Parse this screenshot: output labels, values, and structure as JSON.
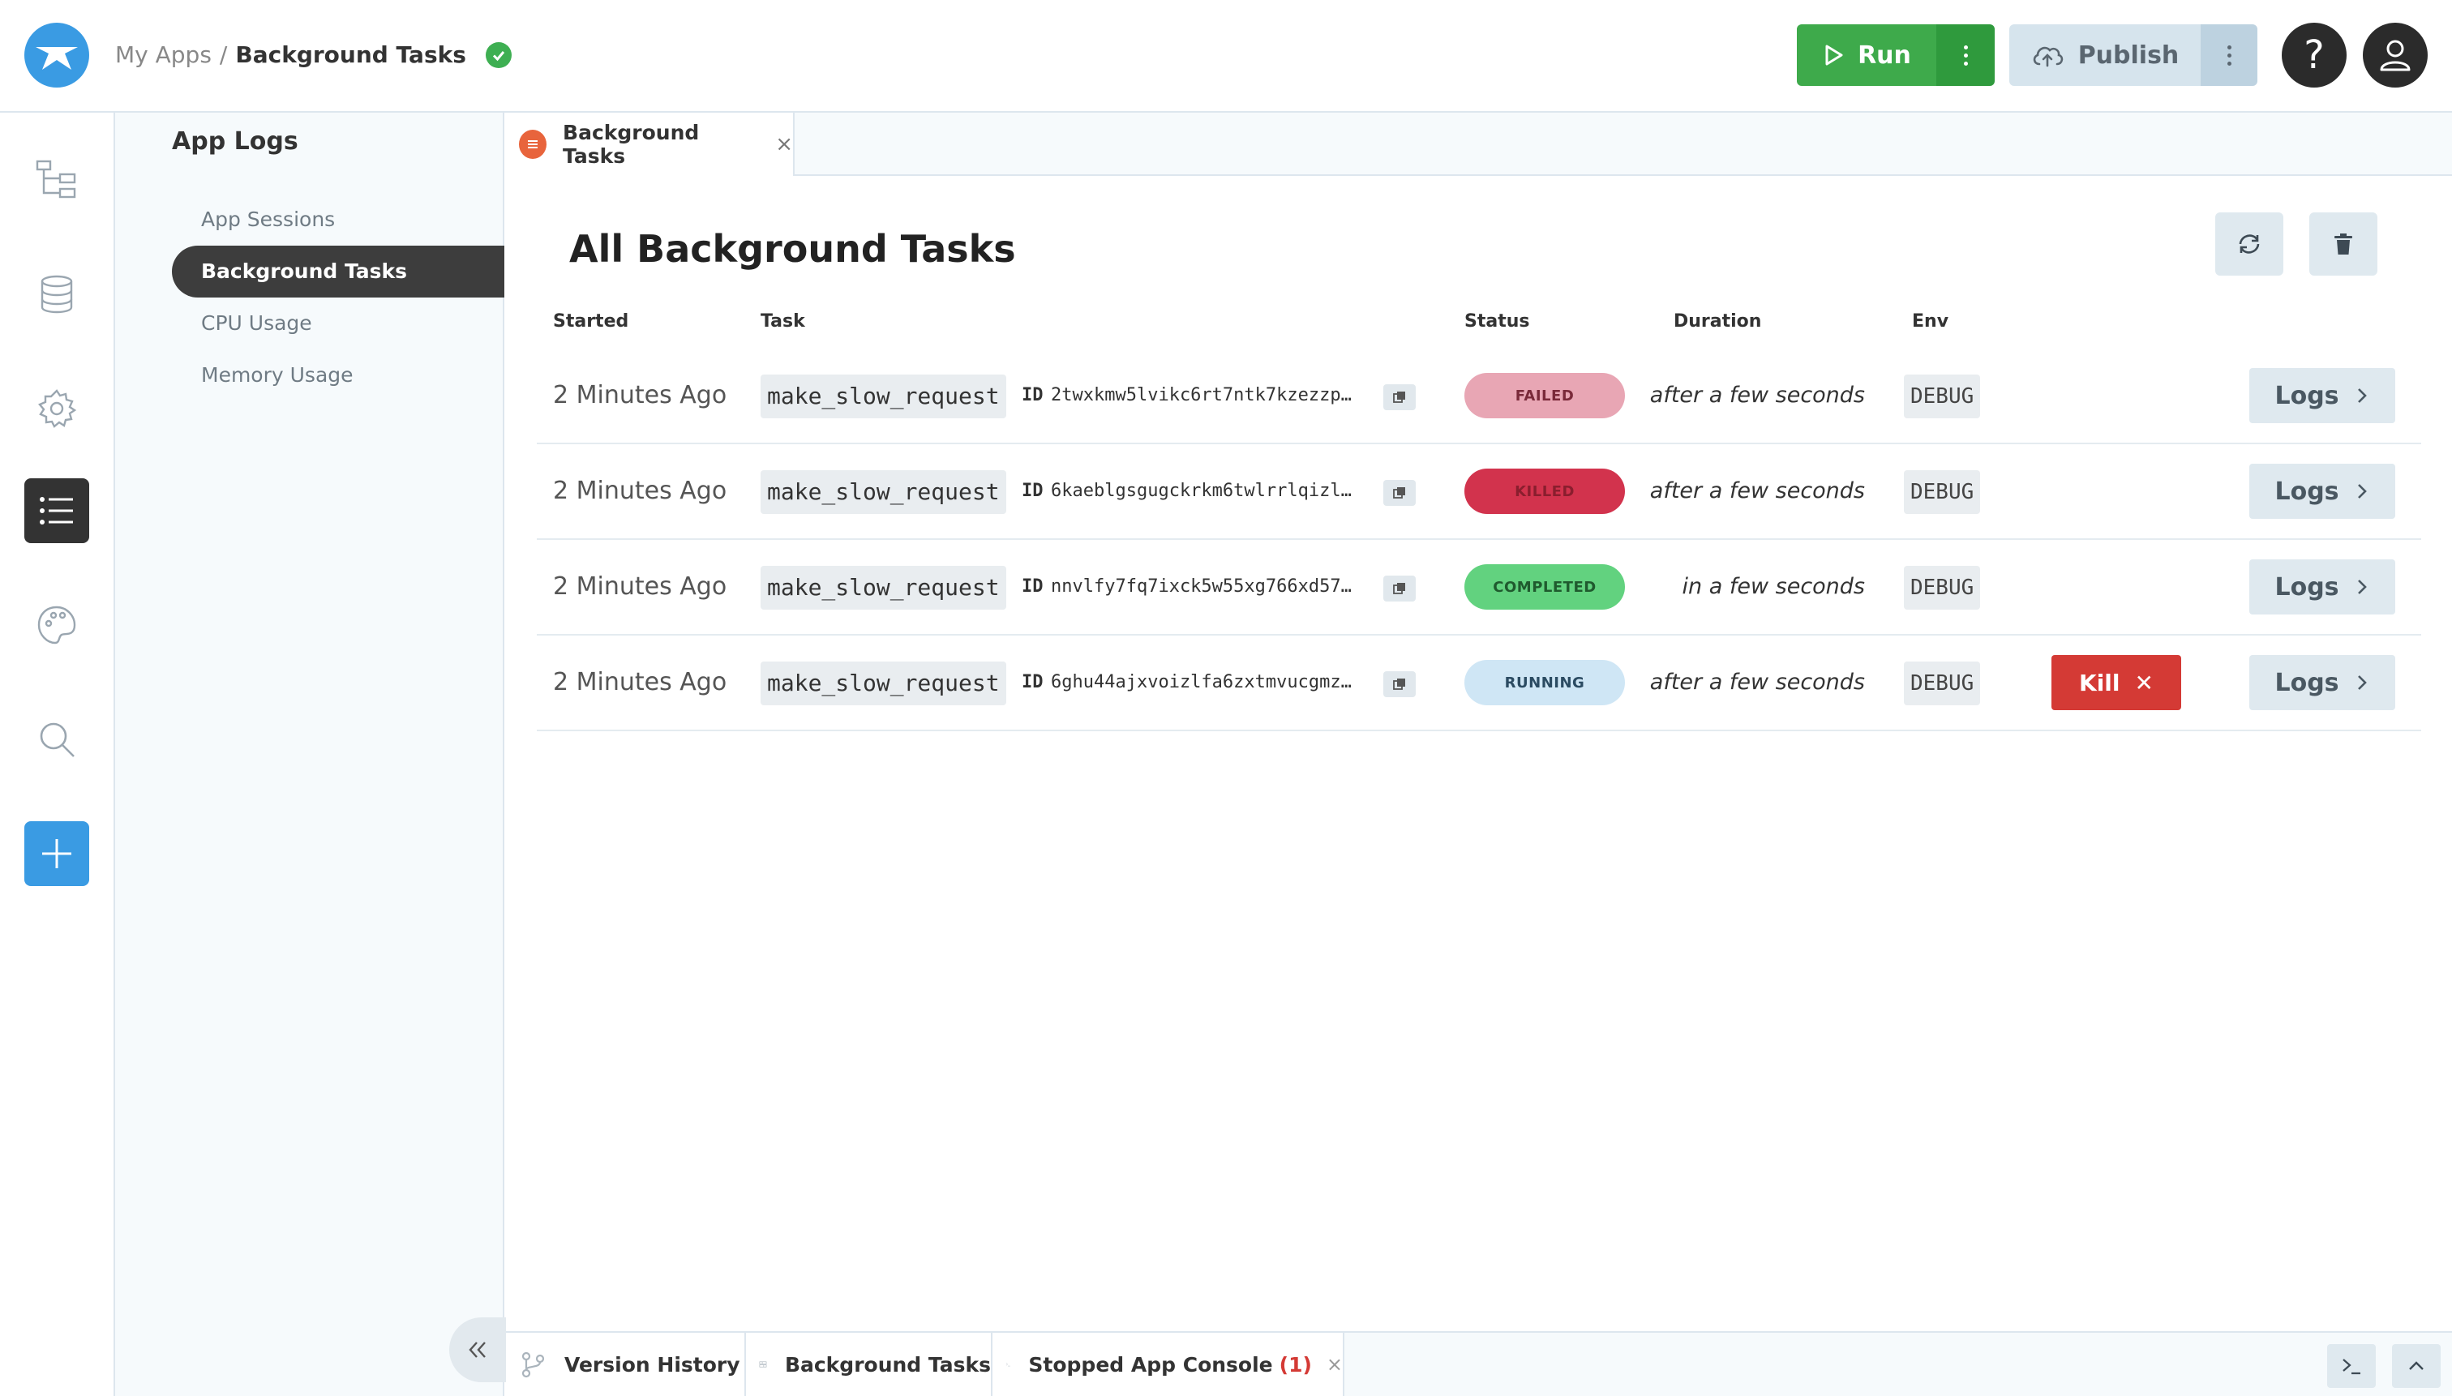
{
  "header": {
    "breadcrumb_root": "My Apps",
    "breadcrumb_separator": "/",
    "breadcrumb_current": "Background Tasks",
    "run_label": "Run",
    "publish_label": "Publish",
    "help_label": "?",
    "colors": {
      "run": "#3eaa4b",
      "publish": "#d6e4ed",
      "brand": "#3a9be3"
    }
  },
  "rail": {
    "icons": [
      "files-icon",
      "database-icon",
      "settings-icon",
      "logs-icon",
      "palette-icon",
      "search-icon",
      "add-icon"
    ],
    "active": "logs-icon"
  },
  "subnav": {
    "title": "App Logs",
    "items": [
      {
        "label": "App Sessions"
      },
      {
        "label": "Background Tasks"
      },
      {
        "label": "CPU Usage"
      },
      {
        "label": "Memory Usage"
      }
    ],
    "active_index": 1
  },
  "tab": {
    "label": "Background Tasks",
    "close": "×"
  },
  "main": {
    "title": "All Background Tasks",
    "columns": [
      "Started",
      "Task",
      "Status",
      "Duration",
      "Env"
    ],
    "rows": [
      {
        "started": "2 Minutes Ago",
        "task": "make_slow_request",
        "id_label": "ID",
        "id": "2twxkmw5lvikc6rt7ntk7kzezzp…",
        "status": "FAILED",
        "duration": "after a few seconds",
        "env": "DEBUG",
        "logs": "Logs"
      },
      {
        "started": "2 Minutes Ago",
        "task": "make_slow_request",
        "id_label": "ID",
        "id": "6kaeblgsgugckrkm6twlrrlqizl…",
        "status": "KILLED",
        "duration": "after a few seconds",
        "env": "DEBUG",
        "logs": "Logs"
      },
      {
        "started": "2 Minutes Ago",
        "task": "make_slow_request",
        "id_label": "ID",
        "id": "nnvlfy7fq7ixck5w55xg766xd57…",
        "status": "COMPLETED",
        "duration": "in a few seconds",
        "env": "DEBUG",
        "logs": "Logs"
      },
      {
        "started": "2 Minutes Ago",
        "task": "make_slow_request",
        "id_label": "ID",
        "id": "6ghu44ajxvoizlfa6zxtmvucgmz…",
        "status": "RUNNING",
        "duration": "after a few seconds",
        "env": "DEBUG",
        "kill": "Kill",
        "logs": "Logs"
      }
    ],
    "status_colors": {
      "FAILED": {
        "bg": "#e8a6b4",
        "fg": "#7a2a3a"
      },
      "KILLED": {
        "bg": "#d2334d",
        "fg": "#8a1e2e"
      },
      "COMPLETED": {
        "bg": "#62d27f",
        "fg": "#1f5a2e"
      },
      "RUNNING": {
        "bg": "#cfe6f5",
        "fg": "#2b4b62"
      }
    }
  },
  "bottombar": {
    "tabs": [
      {
        "label": "Version History"
      },
      {
        "label": "Background Tasks"
      },
      {
        "label": "Stopped App Console",
        "count": "(1)",
        "close": "×"
      }
    ]
  }
}
